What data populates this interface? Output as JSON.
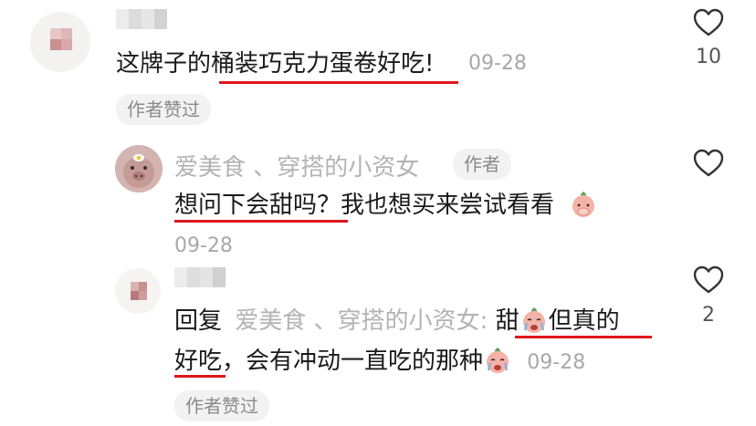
{
  "comments": [
    {
      "text": "这牌子的桶装巧克力蛋卷好吃!",
      "time": "09-28",
      "badge": "作者赞过",
      "like_count": "10",
      "icon": "heart-outline-icon"
    },
    {
      "username": "爱美食 、穿搭的小资女",
      "author_tag": "作者",
      "text": "想问下会甜吗？我也想买来尝试看看",
      "time": "09-28",
      "like_count": "",
      "icon": "heart-outline-icon"
    },
    {
      "reply_prefix": "回复",
      "reply_to": "爱美食 、穿搭的小资女:",
      "text_line1_a": "甜",
      "text_line1_b": "但真的",
      "text_line2_a": "好吃",
      "text_line2_b": "，会有冲动一直吃的那种",
      "time": "09-28",
      "badge": "作者赞过",
      "like_count": "2",
      "icon": "heart-outline-icon"
    }
  ],
  "colors": {
    "underline": "#e0161d",
    "muted": "#b3b3b3",
    "pill_bg": "#f2f2f2"
  }
}
